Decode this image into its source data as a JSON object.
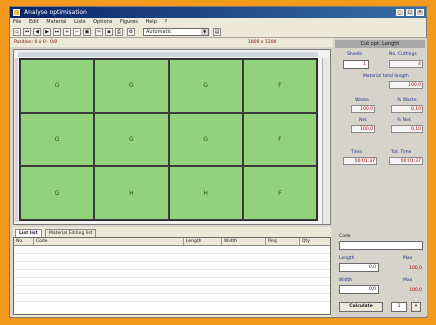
{
  "window": {
    "title": "Analyse optimisation"
  },
  "menu": [
    "File",
    "Edit",
    "Material",
    "Lists",
    "Options",
    "Figures",
    "Help",
    "?"
  ],
  "toolbar": {
    "select_value": "Automatic"
  },
  "infobar": {
    "left": "Position: 0 x 0 · 0/0",
    "right": "1800 x 1200"
  },
  "grid": {
    "rows": [
      [
        "G",
        "G",
        "G",
        "F"
      ],
      [
        "G",
        "G",
        "G",
        "F"
      ],
      [
        "G",
        "H",
        "H",
        "F"
      ]
    ]
  },
  "right_panel": {
    "header": "Cut opt. Length",
    "sheets_label": "Sheets",
    "sheets_value": "1",
    "nr_cuts_label": "No. Cuttings",
    "nr_cuts_value": "4",
    "total_length_label": "Material total length",
    "total_length_value": "100,0",
    "waste_label": "Waste",
    "waste_value": "100,0",
    "waste_pct_label": "% Waste",
    "waste_pct_value": "0,10",
    "net_label": "Net",
    "net_value": "100,0",
    "net_pct_label": "% Net",
    "net_pct_value": "0,10",
    "time_label": "Time",
    "time_value": "00:01:37",
    "total_time_label": "Tot. Time",
    "total_time_value": "00:01:37",
    "code_label": "Code",
    "length_label": "Length",
    "length_value": "0,0",
    "width_label": "Width",
    "width_value": "0,0",
    "max1_label": "Max",
    "max1_value": "100,0",
    "max2_label": "Max",
    "max2_value": "100,0",
    "calc_button": "Calculate",
    "count_value": "1"
  },
  "bottom": {
    "tabs": [
      "List list",
      "Material Editing list"
    ],
    "columns": [
      "No.",
      "Code",
      "Length",
      "Width",
      "Req.",
      "Qty"
    ]
  }
}
